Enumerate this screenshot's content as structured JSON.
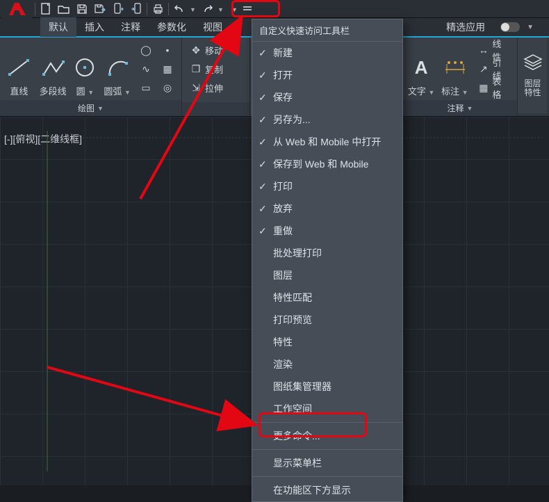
{
  "tabs": {
    "t0": "默认",
    "t1": "插入",
    "t2": "注释",
    "t3": "参数化",
    "t4": "视图",
    "featured": "精选应用"
  },
  "drawPanel": {
    "title": "绘图",
    "line": "直线",
    "polyline": "多段线",
    "circle": "圆",
    "arc": "圆弧"
  },
  "modifyPanel": {
    "move": "移动",
    "copy": "复制",
    "stretch": "拉伸"
  },
  "annotPanel": {
    "title": "注释",
    "text": "文字",
    "dim": "标注",
    "linetype": "线性",
    "leader": "引线",
    "table": "表格"
  },
  "layerPanel": {
    "title": "图层\n特性"
  },
  "viewlabel": "[-][俯视][二维线框]",
  "dropdown": {
    "title": "自定义快速访问工具栏",
    "items": [
      {
        "label": "新建",
        "checked": true
      },
      {
        "label": "打开",
        "checked": true
      },
      {
        "label": "保存",
        "checked": true
      },
      {
        "label": "另存为...",
        "checked": true
      },
      {
        "label": "从 Web 和 Mobile 中打开",
        "checked": true
      },
      {
        "label": "保存到 Web 和 Mobile",
        "checked": true
      },
      {
        "label": "打印",
        "checked": true
      },
      {
        "label": "放弃",
        "checked": true
      },
      {
        "label": "重做",
        "checked": true
      },
      {
        "label": "批处理打印",
        "checked": false
      },
      {
        "label": "图层",
        "checked": false
      },
      {
        "label": "特性匹配",
        "checked": false
      },
      {
        "label": "打印预览",
        "checked": false
      },
      {
        "label": "特性",
        "checked": false
      },
      {
        "label": "渲染",
        "checked": false
      },
      {
        "label": "图纸集管理器",
        "checked": false
      },
      {
        "label": "工作空间",
        "checked": false
      }
    ],
    "more": "更多命令...",
    "showmenu": "显示菜单栏",
    "below": "在功能区下方显示"
  }
}
